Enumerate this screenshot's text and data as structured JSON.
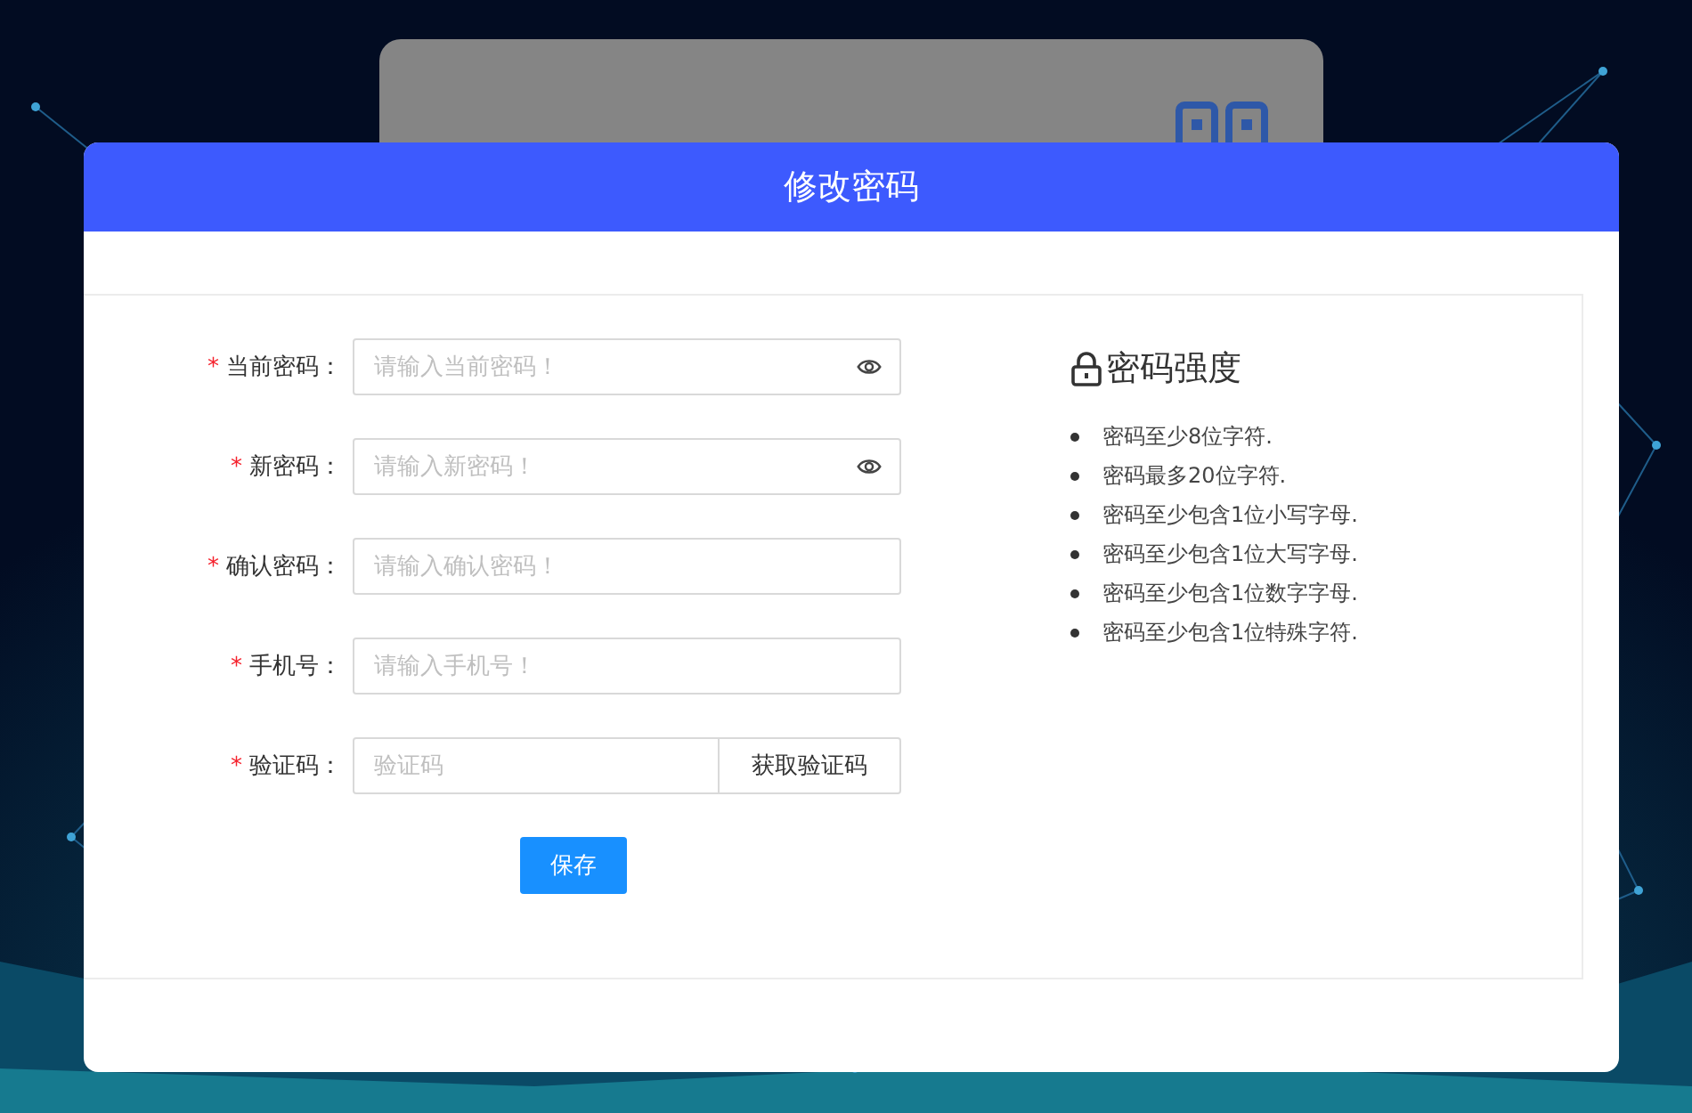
{
  "dialog": {
    "title": "修改密码",
    "fields": [
      {
        "label": "当前密码：",
        "required_mark": "*",
        "placeholder": "请输入当前密码！",
        "kind": "password"
      },
      {
        "label": "新密码：",
        "required_mark": "*",
        "placeholder": "请输入新密码！",
        "kind": "password"
      },
      {
        "label": "确认密码：",
        "required_mark": "*",
        "placeholder": "请输入确认密码！",
        "kind": "text"
      },
      {
        "label": "手机号：",
        "required_mark": "*",
        "placeholder": "请输入手机号！",
        "kind": "text"
      },
      {
        "label": "验证码：",
        "required_mark": "*",
        "placeholder": "验证码",
        "kind": "code",
        "button": "获取验证码"
      }
    ],
    "save_button": "保存",
    "strength": {
      "title": "密码强度",
      "rules": [
        "密码至少8位字符.",
        "密码最多20位字符.",
        "密码至少包含1位小写字母.",
        "密码至少包含1位大写字母.",
        "密码至少包含1位数字字母.",
        "密码至少包含1位特殊字符."
      ]
    }
  }
}
